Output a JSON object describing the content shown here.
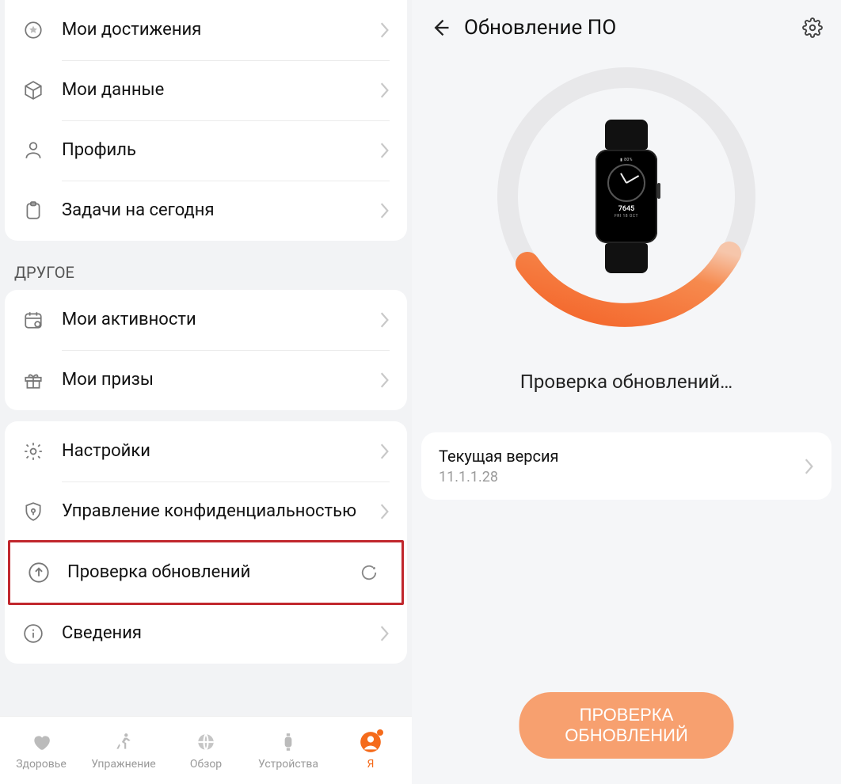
{
  "left": {
    "group1": [
      {
        "icon": "medal",
        "label": "Мои достижения"
      },
      {
        "icon": "cube",
        "label": "Мои данные"
      },
      {
        "icon": "person",
        "label": "Профиль"
      },
      {
        "icon": "clipboard",
        "label": "Задачи на сегодня"
      }
    ],
    "section2_title": "ДРУГОЕ",
    "group2": [
      {
        "icon": "calendar",
        "label": "Мои активности"
      },
      {
        "icon": "gift",
        "label": "Мои призы"
      }
    ],
    "group3": [
      {
        "icon": "gear",
        "label": "Настройки"
      },
      {
        "icon": "shield",
        "label": "Управление конфиденциальностью"
      },
      {
        "icon": "upload",
        "label": "Проверка обновлений",
        "loading": true,
        "highlight": true
      },
      {
        "icon": "info",
        "label": "Сведения"
      }
    ],
    "nav": [
      {
        "icon": "heart",
        "label": "Здоровье"
      },
      {
        "icon": "run",
        "label": "Упражнение"
      },
      {
        "icon": "globe",
        "label": "Обзор"
      },
      {
        "icon": "watch",
        "label": "Устройства"
      },
      {
        "icon": "avatar",
        "label": "Я",
        "active": true,
        "dot": true
      }
    ]
  },
  "right": {
    "header_title": "Обновление ПО",
    "watchface": {
      "steps": "7645",
      "date": "FRI 18 OCT"
    },
    "status_text": "Проверка обновлений…",
    "version_label": "Текущая версия",
    "version_value": "11.1.1.28",
    "button_label": "ПРОВЕРКА ОБНОВЛЕНИЙ"
  }
}
